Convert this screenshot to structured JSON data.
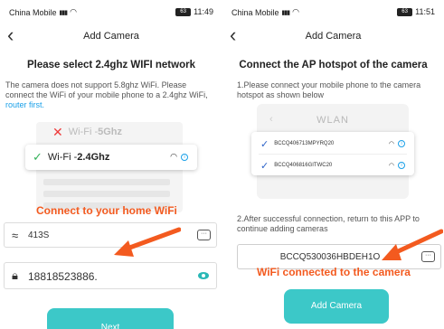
{
  "left": {
    "status": {
      "carrier": "China Mobile",
      "battery": "63",
      "time": "11:49"
    },
    "title": "Add Camera",
    "heading": "Please select 2.4ghz WIFI network",
    "description": "The camera does not support 5.8ghz WiFi. Please connect the WiFi of your mobile phone to a 2.4ghz WiFi,",
    "description_link": "router first.",
    "wifi_5g": {
      "prefix": "Wi-Fi - ",
      "band": "5Ghz"
    },
    "wifi_24g": {
      "prefix": "Wi-Fi - ",
      "band": "2.4Ghz"
    },
    "annotation": "Connect to your home WiFi",
    "ssid_value": "413S",
    "password_value": "18818523886.",
    "next_label": "Next"
  },
  "right": {
    "status": {
      "carrier": "China Mobile",
      "battery": "63",
      "time": "11:51"
    },
    "title": "Add Camera",
    "heading": "Connect the AP hotspot of the camera",
    "step1": "1.Please connect your mobile phone to the camera hotspot as shown below",
    "wlan_label": "WLAN",
    "ap_list": [
      "BCCQ406713MPYRQ20",
      "BCCQ406816GITWC20"
    ],
    "step2": "2.After successful connection, return to this APP to continue adding cameras",
    "connected_value": "BCCQ530036HBDEH1O",
    "annotation": "WiFi connected to the camera",
    "add_camera_label": "Add Camera"
  },
  "colors": {
    "accent": "#3cc8c8",
    "annotation": "#f35a1f",
    "link": "#1aa0e8",
    "check_green": "#34b25a",
    "check_blue": "#2d63c8",
    "error_red": "#ee3b3b"
  }
}
